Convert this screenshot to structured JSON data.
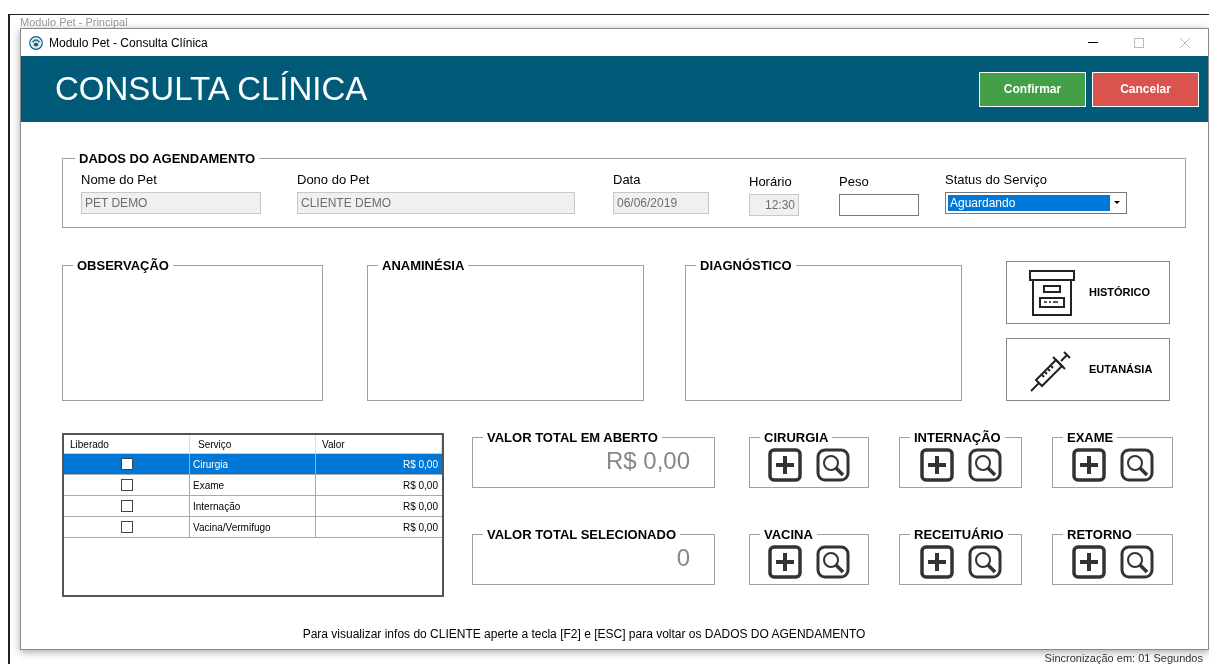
{
  "background_window": {
    "title": "Modulo Pet - Principal",
    "status": "Sincronização em: 01 Segundos"
  },
  "window": {
    "title": "Modulo Pet - Consulta Clínica"
  },
  "header": {
    "title": "CONSULTA CLÍNICA",
    "buttons": [
      {
        "label": "Confirmar",
        "kind": "confirm"
      },
      {
        "label": "Cancelar",
        "kind": "cancel"
      }
    ]
  },
  "agendamento": {
    "title": "DADOS DO AGENDAMENTO",
    "fields": [
      {
        "label": "Nome do Pet",
        "value": "PET DEMO",
        "kind": "readonly"
      },
      {
        "label": "Dono do Pet",
        "value": "CLIENTE DEMO",
        "kind": "readonly"
      },
      {
        "label": "Data",
        "value": "06/06/2019",
        "kind": "readonly"
      },
      {
        "label": "Horário",
        "value": "12:30",
        "kind": "time"
      },
      {
        "label": "Peso",
        "kind": "input"
      },
      {
        "label": "Status do Serviço",
        "value": "Aguardando",
        "kind": "select"
      }
    ]
  },
  "notes": [
    {
      "title": "OBSERVAÇÃO"
    },
    {
      "title": "ANAMINÉSIA"
    },
    {
      "title": "DIAGNÓSTICO"
    }
  ],
  "side_buttons": [
    {
      "label": "HISTÓRICO",
      "kind": "archive"
    },
    {
      "label": "EUTANÁSIA",
      "kind": "syringe"
    }
  ],
  "table": {
    "columns": [
      "Liberado",
      "Serviço",
      "Valor"
    ],
    "rows": [
      {
        "checked": false,
        "service": "Cirurgia",
        "value": "R$ 0,00",
        "selected": true
      },
      {
        "checked": false,
        "service": "Exame",
        "value": "R$ 0,00",
        "selected": false
      },
      {
        "checked": false,
        "service": "Internação",
        "value": "R$ 0,00",
        "selected": false
      },
      {
        "checked": false,
        "service": "Vacina/Vermifugo",
        "value": "R$ 0,00",
        "selected": false
      }
    ]
  },
  "totals": [
    {
      "title": "VALOR TOTAL EM ABERTO",
      "value": "R$ 0,00"
    },
    {
      "title": "VALOR TOTAL SELECIONADO",
      "value": "0"
    }
  ],
  "actions": [
    {
      "title": "CIRURGIA"
    },
    {
      "title": "INTERNAÇÃO"
    },
    {
      "title": "EXAME"
    },
    {
      "title": "VACINA"
    },
    {
      "title": "RECEITUÁRIO"
    },
    {
      "title": "RETORNO"
    }
  ],
  "footer": "Para visualizar infos do CLIENTE aperte a tecla [F2] e [ESC] para voltar os DADOS DO AGENDAMENTO"
}
